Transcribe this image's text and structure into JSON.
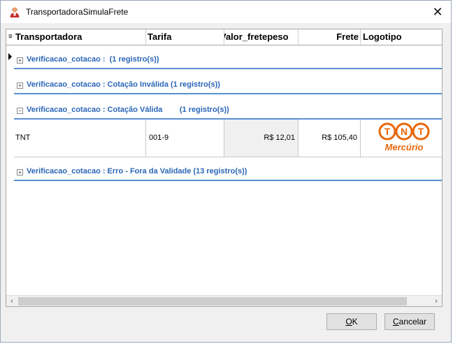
{
  "window": {
    "title": "TransportadoraSimulaFrete",
    "close_glyph": "✕"
  },
  "grid": {
    "column_selector_glyph": "≡",
    "columns": [
      "Transportadora",
      "Tarifa",
      "Valor_fretepeso",
      "Frete",
      "Logotipo"
    ],
    "groups": [
      {
        "expander": "+",
        "label": "Verificacao_cotacao :  (1 registro(s))"
      },
      {
        "expander": "+",
        "label": "Verificacao_cotacao : Cotação Inválida (1 registro(s))"
      },
      {
        "expander": "−",
        "label": "Verificacao_cotacao : Cotação Válida        (1 registro(s))"
      },
      {
        "expander": "+",
        "label": "Verificacao_cotacao : Erro - Fora da Validade (13 registro(s))"
      }
    ],
    "row": {
      "transportadora": "TNT",
      "tarifa": "001-9",
      "valor_fretepeso": "R$ 12,01",
      "frete": "R$ 105,40",
      "logo_text": "TNT",
      "logo_sub": "Mercúrio"
    },
    "scroll_left": "‹",
    "scroll_right": "›"
  },
  "buttons": {
    "ok_prefix": "",
    "ok_mnemonic": "O",
    "ok_rest": "K",
    "cancel_mnemonic": "C",
    "cancel_rest": "ancelar"
  },
  "colors": {
    "group_text": "#2a66b8",
    "group_line": "#5b8fd0",
    "logo": "#e8680c"
  }
}
